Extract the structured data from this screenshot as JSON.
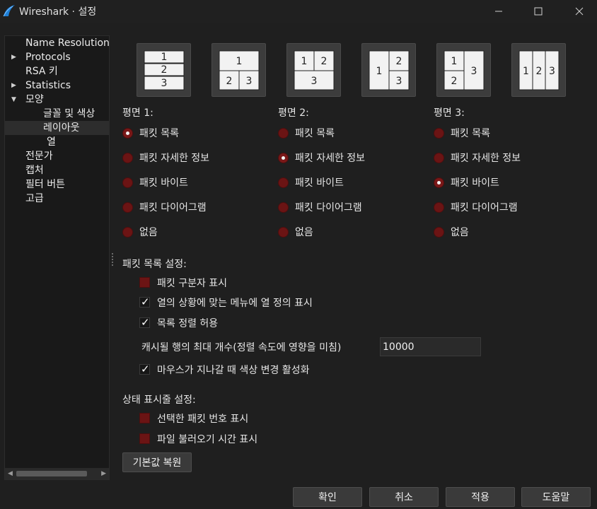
{
  "window": {
    "title": "Wireshark · 설정",
    "min_glyph": "—",
    "max_glyph": "☐",
    "close_glyph": "✕",
    "accent": "#6b1414"
  },
  "sidebar": {
    "items": [
      {
        "label": "Name Resolution",
        "arrow": ""
      },
      {
        "label": "Protocols",
        "arrow": "▶"
      },
      {
        "label": "RSA 키",
        "arrow": ""
      },
      {
        "label": "Statistics",
        "arrow": "▶"
      },
      {
        "label": "모양",
        "arrow": "▼"
      },
      {
        "label": "글꼴 및 색상",
        "arrow": ""
      },
      {
        "label": "레이아웃",
        "arrow": ""
      },
      {
        "label": "열",
        "arrow": ""
      },
      {
        "label": "전문가",
        "arrow": ""
      },
      {
        "label": "캡처",
        "arrow": ""
      },
      {
        "label": "필터 버튼",
        "arrow": ""
      },
      {
        "label": "고급",
        "arrow": ""
      }
    ],
    "selected": "레이아웃",
    "scroll_left": "◀",
    "scroll_right": "▶"
  },
  "layouts": {
    "labels": {
      "one": "1",
      "two": "2",
      "three": "3"
    }
  },
  "panes": [
    {
      "label": "평면 1:",
      "options": [
        "패킷 목록",
        "패킷 자세한 정보",
        "패킷 바이트",
        "패킷 다이어그램",
        "없음"
      ],
      "selected": 0
    },
    {
      "label": "평면 2:",
      "options": [
        "패킷 목록",
        "패킷 자세한 정보",
        "패킷 바이트",
        "패킷 다이어그램",
        "없음"
      ],
      "selected": 1
    },
    {
      "label": "평면 3:",
      "options": [
        "패킷 목록",
        "패킷 자세한 정보",
        "패킷 바이트",
        "패킷 다이어그램",
        "없음"
      ],
      "selected": 2
    }
  ],
  "packet_list_settings": {
    "title": "패킷 목록 설정:",
    "show_separator": {
      "label": "패킷 구분자 표시",
      "checked": false
    },
    "column_defs_in_menu": {
      "label": "열의 상황에 맞는 메뉴에 열 정의 표시",
      "checked": true
    },
    "allow_sorting": {
      "label": "목록 정렬 허용",
      "checked": true
    },
    "cache_rows_label": "캐시될 행의 최대 개수(정렬 속도에 영향을 미침)",
    "cache_rows_value": "10000",
    "hover_color": {
      "label": "마우스가 지나갈 때 색상 변경 활성화",
      "checked": true
    }
  },
  "status_bar_settings": {
    "title": "상태 표시줄 설정:",
    "show_selected_packet": {
      "label": "선택한 패킷 번호 표시",
      "checked": false
    },
    "show_file_load_time": {
      "label": "파일 불러오기 시간 표시",
      "checked": false
    }
  },
  "buttons": {
    "restore_defaults": "기본값 복원",
    "ok": "확인",
    "cancel": "취소",
    "apply": "적용",
    "help": "도움말"
  }
}
